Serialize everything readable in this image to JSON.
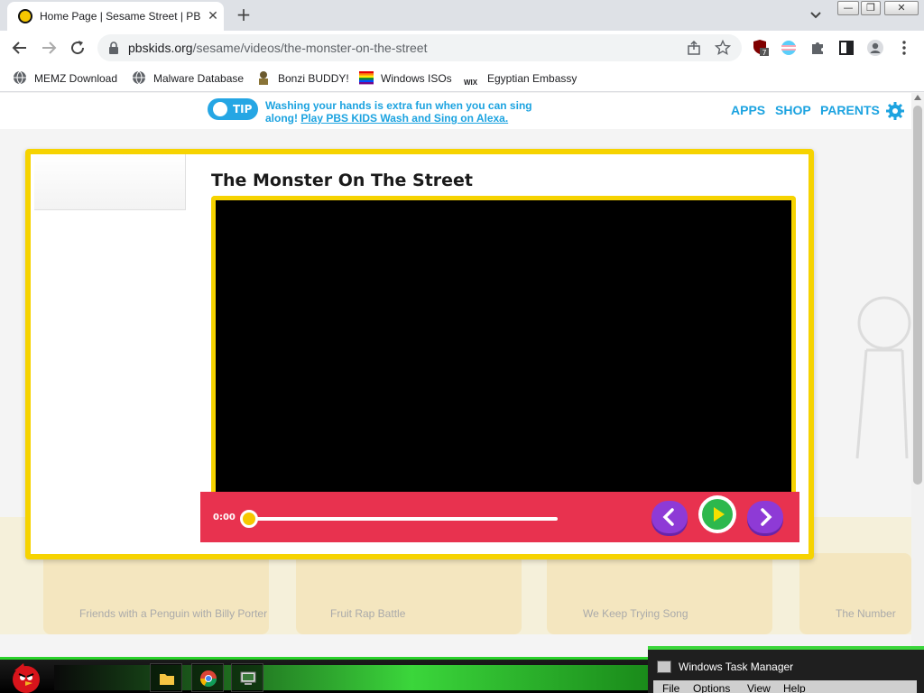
{
  "browser": {
    "tab_title": "Home Page | Sesame Street | PBS",
    "tab_close": "✕",
    "new_tab": "+",
    "window_controls": {
      "minimize": "—",
      "maximize": "❐",
      "close": "✕"
    },
    "url_domain": "pbskids.org",
    "url_path": "/sesame/videos/the-monster-on-the-street",
    "extension_badge": "7",
    "bookmarks": [
      {
        "label": "MEMZ Download",
        "icon": "globe-icon"
      },
      {
        "label": "Malware Database",
        "icon": "globe-icon"
      },
      {
        "label": "Bonzi BUDDY!",
        "icon": "bonzi-icon"
      },
      {
        "label": "Windows ISOs",
        "icon": "rainbow-icon"
      },
      {
        "label": "Egyptian Embassy",
        "icon": "wix-icon"
      }
    ],
    "wix_text": "WIX"
  },
  "header": {
    "tip_badge": "TIP",
    "tip_text": "Washing your hands is extra fun when you can sing along!",
    "tip_link": "Play PBS KIDS Wash and Sing on Alexa.",
    "nav": [
      "APPS",
      "SHOP",
      "PARENTS"
    ]
  },
  "background": {
    "cards": [
      "Friends with a Penguin with Billy Porter",
      "Fruit Rap Battle",
      "We Keep Trying Song",
      "The Number"
    ]
  },
  "video": {
    "title": "The Monster On The Street",
    "time": "0:00",
    "progress": 0
  },
  "taskbar": {
    "taskmgr_title": "Windows Task Manager",
    "taskmgr_menu": [
      "File",
      "Options",
      "View",
      "Help"
    ]
  },
  "colors": {
    "accent_blue": "#1ca3e0",
    "frame_yellow": "#f6d300",
    "player_red": "#e8324f",
    "nav_purple": "#8e3ad6",
    "play_green": "#2db84d",
    "taskbar_green": "#3bd63b"
  }
}
